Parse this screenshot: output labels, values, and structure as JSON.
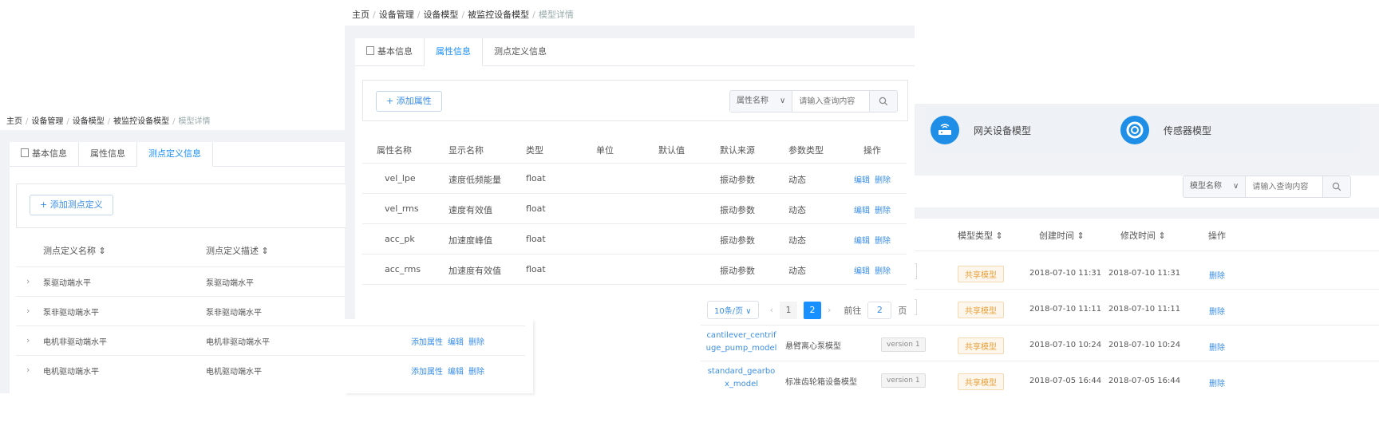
{
  "left": {
    "breadcrumb": [
      "主页",
      "设备管理",
      "设备模型",
      "被监控设备模型",
      "模型详情"
    ],
    "tabs": [
      "基本信息",
      "属性信息",
      "测点定义信息"
    ],
    "add_button": "+ 添加测点定义",
    "headers": [
      "测点定义名称 ⇕",
      "测点定义描述 ⇕"
    ],
    "rows": [
      {
        "name": "泵驱动端水平",
        "desc": "泵驱动端水平"
      },
      {
        "name": "泵非驱动端水平",
        "desc": "泵非驱动端水平"
      },
      {
        "name": "电机非驱动端水平",
        "desc": "电机非驱动端水平",
        "ops": [
          "添加属性",
          "编辑",
          "删除"
        ]
      },
      {
        "name": "电机驱动端水平",
        "desc": "电机驱动端水平",
        "ops": [
          "添加属性",
          "编辑",
          "删除"
        ]
      }
    ]
  },
  "center": {
    "breadcrumb": [
      "主页",
      "设备管理",
      "设备模型",
      "被监控设备模型",
      "模型详情"
    ],
    "tabs": [
      "基本信息",
      "属性信息",
      "测点定义信息"
    ],
    "add_button": "+ 添加属性",
    "search": {
      "select": "属性名称",
      "placeholder": "请输入查询内容"
    },
    "headers": [
      "属性名称",
      "显示名称",
      "类型",
      "单位",
      "默认值",
      "默认来源",
      "参数类型",
      "操作"
    ],
    "rows": [
      {
        "name": "vel_lpe",
        "display": "速度低频能量",
        "type": "float",
        "unit": "",
        "default": "",
        "source": "振动参数",
        "param": "动态",
        "ops": [
          "编辑",
          "删除"
        ]
      },
      {
        "name": "vel_rms",
        "display": "速度有效值",
        "type": "float",
        "unit": "",
        "default": "",
        "source": "振动参数",
        "param": "动态",
        "ops": [
          "编辑",
          "删除"
        ]
      },
      {
        "name": "acc_pk",
        "display": "加速度峰值",
        "type": "float",
        "unit": "",
        "default": "",
        "source": "振动参数",
        "param": "动态",
        "ops": [
          "编辑",
          "删除"
        ]
      },
      {
        "name": "acc_rms",
        "display": "加速度有效值",
        "type": "float",
        "unit": "",
        "default": "",
        "source": "振动参数",
        "param": "动态",
        "ops": [
          "编辑",
          "删除"
        ]
      }
    ],
    "pager": {
      "size": "10条/页",
      "pages": [
        "1",
        "2"
      ],
      "current": "2",
      "jump_prefix": "前往",
      "jump_value": "2",
      "jump_suffix": "页"
    }
  },
  "right": {
    "cards": [
      "网关设备模型",
      "传感器模型"
    ],
    "search": {
      "select": "模型名称",
      "placeholder": "请输入查询内容"
    },
    "headers": [
      "模型类型 ⇕",
      "创建时间 ⇕",
      "修改时间 ⇕",
      "操作"
    ],
    "rows": [
      {
        "name": "",
        "display": "",
        "version": "",
        "type": "共享模型",
        "created": "2018-07-10 11:31",
        "modified": "2018-07-10 11:31",
        "op": "删除"
      },
      {
        "name": "",
        "display": "",
        "version": "",
        "type": "共享模型",
        "created": "2018-07-10 11:11",
        "modified": "2018-07-10 11:11",
        "op": "删除"
      },
      {
        "name": "cantilever_centrifuge_pump_model",
        "display": "悬臂离心泵模型",
        "version": "version 1",
        "type": "共享模型",
        "created": "2018-07-10 10:24",
        "modified": "2018-07-10 10:24",
        "op": "删除"
      },
      {
        "name": "standard_gearbox_model",
        "display": "标准齿轮箱设备模型",
        "version": "version 1",
        "type": "共享模型",
        "created": "2018-07-05 16:44",
        "modified": "2018-07-05 16:44",
        "op": "删除"
      }
    ]
  }
}
